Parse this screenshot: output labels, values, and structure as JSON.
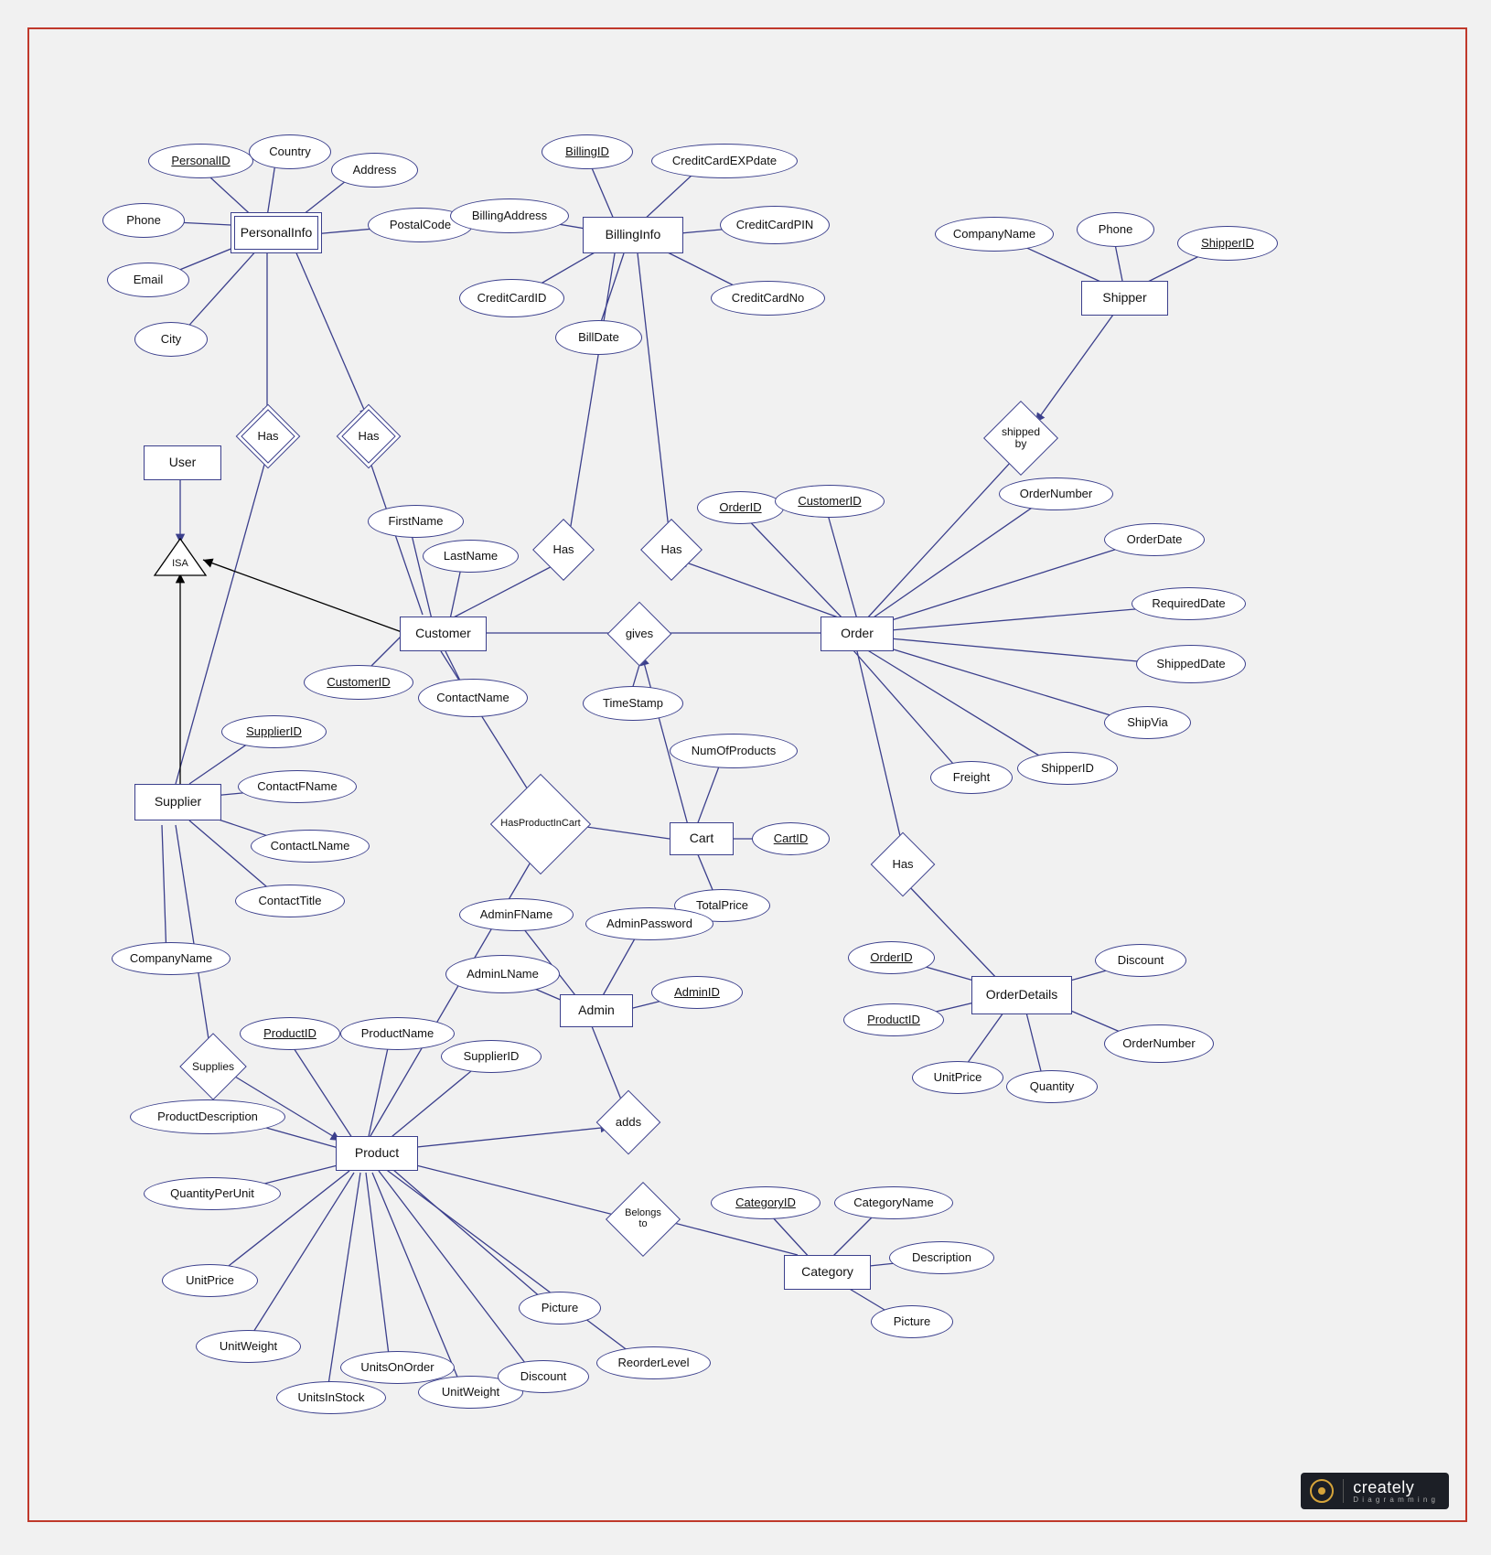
{
  "logo": {
    "brand": "creately",
    "tagline": "D i a g r a m m i n g"
  },
  "entities": {
    "user": {
      "label": "User"
    },
    "personalinfo": {
      "label": "PersonalInfo"
    },
    "billinginfo": {
      "label": "BillingInfo"
    },
    "shipper": {
      "label": "Shipper"
    },
    "customer": {
      "label": "Customer"
    },
    "order": {
      "label": "Order"
    },
    "supplier": {
      "label": "Supplier"
    },
    "cart": {
      "label": "Cart"
    },
    "admin": {
      "label": "Admin"
    },
    "orderdetails": {
      "label": "OrderDetails"
    },
    "product": {
      "label": "Product"
    },
    "category": {
      "label": "Category"
    }
  },
  "relationships": {
    "has1": {
      "label": "Has"
    },
    "has2": {
      "label": "Has"
    },
    "hasBill1": {
      "label": "Has"
    },
    "hasBill2": {
      "label": "Has"
    },
    "shippedby": {
      "label": "shipped by"
    },
    "gives": {
      "label": "gives"
    },
    "hasprodcart": {
      "label": "HasProductInCart"
    },
    "hasOD": {
      "label": "Has"
    },
    "supplies": {
      "label": "Supplies"
    },
    "adds": {
      "label": "adds"
    },
    "belongsto": {
      "label": "Belongs to"
    },
    "isa": {
      "label": "ISA"
    }
  },
  "personalinfo_attrs": {
    "personalid": "PersonalID",
    "country": "Country",
    "address": "Address",
    "postal": "PostalCode",
    "phone": "Phone",
    "email": "Email",
    "city": "City"
  },
  "billinginfo_attrs": {
    "billingid": "BillingID",
    "expdate": "CreditCardEXPdate",
    "billaddr": "BillingAddress",
    "pin": "CreditCardPIN",
    "ccid": "CreditCardID",
    "ccno": "CreditCardNo",
    "billdate": "BillDate"
  },
  "shipper_attrs": {
    "company": "CompanyName",
    "phone": "Phone",
    "shipperid": "ShipperID"
  },
  "customer_attrs": {
    "customerid": "CustomerID",
    "firstname": "FirstName",
    "lastname": "LastName",
    "contactname": "ContactName"
  },
  "order_attrs": {
    "orderid": "OrderID",
    "customerid": "CustomerID",
    "ordernumber": "OrderNumber",
    "orderdate": "OrderDate",
    "required": "RequiredDate",
    "shipped": "ShippedDate",
    "shipvia": "ShipVia",
    "shipperid": "ShipperID",
    "freight": "Freight"
  },
  "gives_attrs": {
    "timestamp": "TimeStamp"
  },
  "cart_attrs": {
    "numprod": "NumOfProducts",
    "cartid": "CartID",
    "total": "TotalPrice"
  },
  "supplier_attrs": {
    "supplierid": "SupplierID",
    "cfname": "ContactFName",
    "clname": "ContactLName",
    "ctitle": "ContactTitle",
    "company": "CompanyName"
  },
  "admin_attrs": {
    "afname": "AdminFName",
    "alname": "AdminLName",
    "apwd": "AdminPassword",
    "adminid": "AdminID"
  },
  "orderdetails_attrs": {
    "orderid": "OrderID",
    "productid": "ProductID",
    "discount": "Discount",
    "ordernum": "OrderNumber",
    "unitprice": "UnitPrice",
    "quantity": "Quantity"
  },
  "product_attrs": {
    "productid": "ProductID",
    "productname": "ProductName",
    "supplierid": "SupplierID",
    "desc": "ProductDescription",
    "qpu": "QuantityPerUnit",
    "unitprice": "UnitPrice",
    "unitweight1": "UnitWeight",
    "stock": "UnitsInStock",
    "onorder": "UnitsOnOrder",
    "unitweight2": "UnitWeight",
    "discount": "Discount",
    "reorder": "ReorderLevel",
    "picture": "Picture"
  },
  "category_attrs": {
    "categoryid": "CategoryID",
    "catname": "CategoryName",
    "desc": "Description",
    "picture": "Picture"
  }
}
